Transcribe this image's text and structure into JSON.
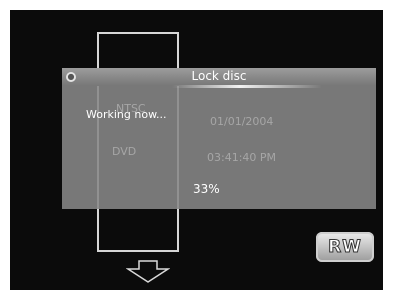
{
  "dialog": {
    "title": "Lock disc",
    "status": "Working now...",
    "progress_label": "33%",
    "progress": 0.33
  },
  "background_info": {
    "format": "NTSC",
    "date": "01/01/2004",
    "media": "DVD",
    "time": "03:41:40 PM"
  },
  "badge": {
    "label": "RW"
  },
  "icons": {
    "close": "close-icon",
    "arrow": "down-arrow-icon"
  }
}
